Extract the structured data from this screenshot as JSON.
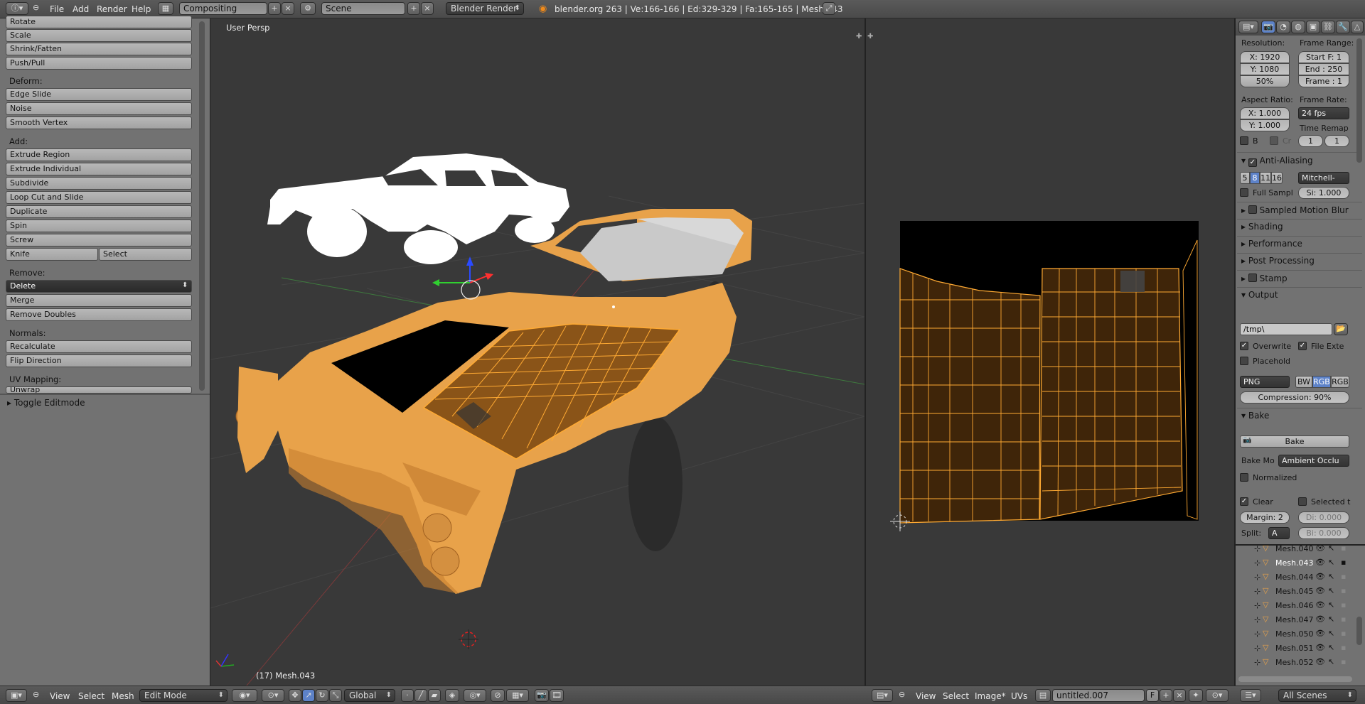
{
  "topbar": {
    "menus": [
      "File",
      "Add",
      "Render",
      "Help"
    ],
    "layout_name": "Compositing",
    "scene_name": "Scene",
    "render_engine": "Blender Render",
    "info": "blender.org 263 | Ve:166-166 | Ed:329-329 | Fa:165-165 | Mesh.043"
  },
  "toolshelf": {
    "transform_items": [
      "Rotate",
      "Scale",
      "Shrink/Fatten",
      "Push/Pull"
    ],
    "deform_header": "Deform:",
    "deform_items": [
      "Edge Slide",
      "Noise",
      "Smooth Vertex"
    ],
    "add_header": "Add:",
    "add_items": [
      "Extrude Region",
      "Extrude Individual",
      "Subdivide",
      "Loop Cut and Slide",
      "Duplicate",
      "Spin",
      "Screw"
    ],
    "knife": "Knife",
    "select": "Select",
    "remove_header": "Remove:",
    "remove_dropdown": "Delete",
    "remove_items": [
      "Merge",
      "Remove Doubles"
    ],
    "normals_header": "Normals:",
    "normals_items": [
      "Recalculate",
      "Flip Direction"
    ],
    "uv_header": "UV Mapping:",
    "uv_partial": "Unwrap",
    "toggle_editmode": "Toggle Editmode"
  },
  "viewport": {
    "view_label": "User Persp",
    "object_label": "(17) Mesh.043"
  },
  "properties": {
    "resolution_label": "Resolution:",
    "res_x": "X: 1920",
    "res_y": "Y: 1080",
    "res_pct": "50%",
    "frame_range_label": "Frame Range:",
    "start": "Start F: 1",
    "end": "End : 250",
    "frame": "Frame : 1",
    "aspect_label": "Aspect Ratio:",
    "aspect_x": "X: 1.000",
    "aspect_y": "Y: 1.000",
    "frame_rate_label": "Frame Rate:",
    "fps": "24 fps",
    "time_remap_label": "Time Remap",
    "remap_old": "1",
    "remap_new": "1",
    "border": "B",
    "crop": "Cr",
    "aa_section": "Anti-Aliasing",
    "aa_samples": [
      "5",
      "8",
      "11",
      "16"
    ],
    "aa_filter": "Mitchell-",
    "full_sample": "Full Sampl",
    "filter_size": "Si: 1.000",
    "sampled_motion_blur": "Sampled Motion Blur",
    "shading": "Shading",
    "performance": "Performance",
    "post_processing": "Post Processing",
    "stamp": "Stamp",
    "output": "Output",
    "output_path": "/tmp\\",
    "overwrite": "Overwrite",
    "file_ext": "File Exte",
    "placeholder": "Placehold",
    "format": "PNG",
    "bw": "BW",
    "rgb": "RGB",
    "rgba": "RGB",
    "compression": "Compression: 90%",
    "bake_section": "Bake",
    "bake_button": "Bake",
    "bake_mode_label": "Bake Mo",
    "bake_mode": "Ambient Occlu",
    "normalized": "Normalized",
    "clear": "Clear",
    "selected_to_active": "Selected t",
    "margin": "Margin: 2",
    "distance": "Di: 0.000",
    "split_label": "Split:",
    "split": "A",
    "bias": "Bi: 0.000"
  },
  "outliner": {
    "items": [
      "Mesh.040",
      "Mesh.043",
      "Mesh.044",
      "Mesh.045",
      "Mesh.046",
      "Mesh.047",
      "Mesh.050",
      "Mesh.051",
      "Mesh.052"
    ],
    "filter": "All Scenes"
  },
  "bottombar": {
    "view3d_menus": [
      "View",
      "Select",
      "Mesh"
    ],
    "mode": "Edit Mode",
    "orientation": "Global",
    "uv_menus": [
      "View",
      "Select",
      "Image*",
      "UVs"
    ],
    "image_name": "untitled.007",
    "image_flag": "F"
  },
  "colors": {
    "mesh_orange": "#e8a24a",
    "selected_face": "#7a4a10",
    "wire": "#ffa030"
  }
}
